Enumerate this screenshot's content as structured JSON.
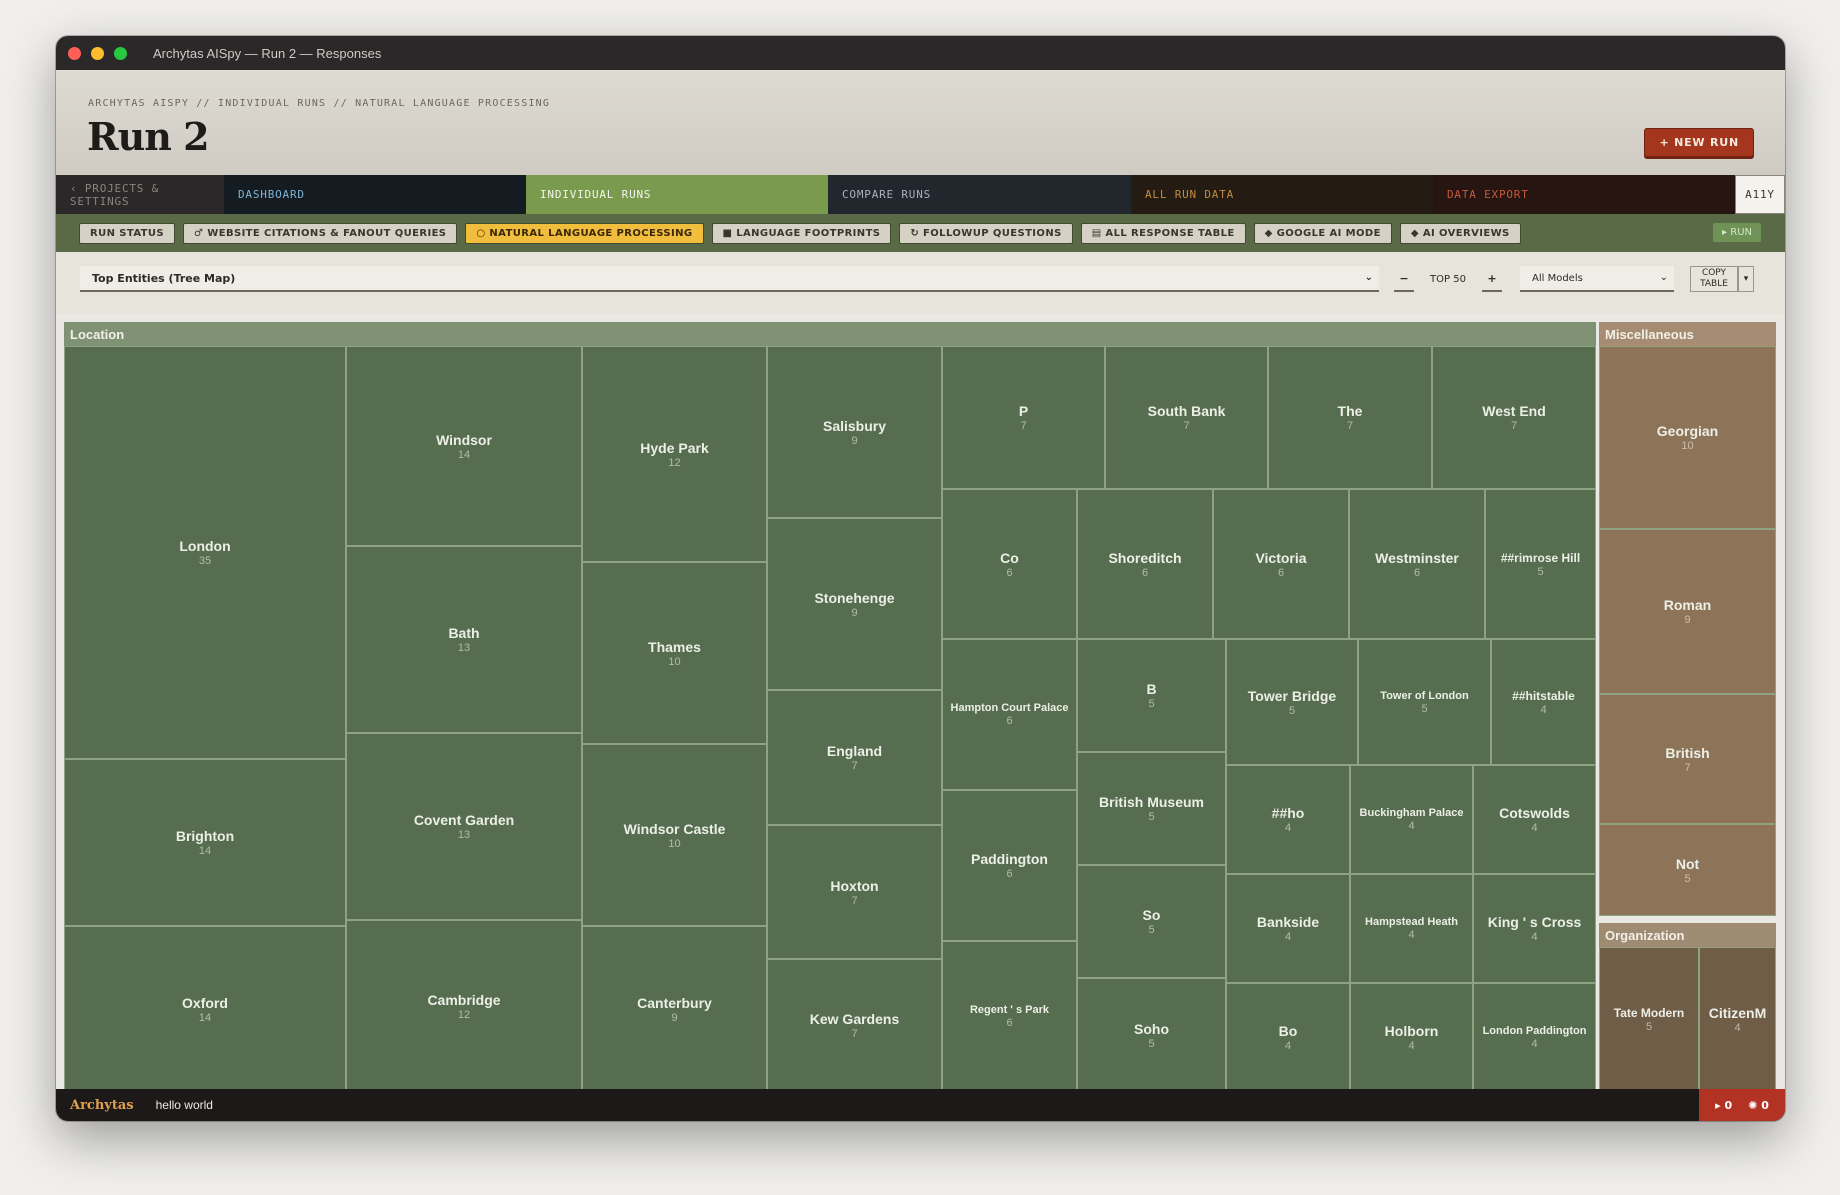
{
  "window": {
    "title": "Archytas AISpy — Run 2 — Responses"
  },
  "header": {
    "breadcrumb": "ARCHYTAS AISPY // INDIVIDUAL RUNS // NATURAL LANGUAGE PROCESSING",
    "title": "Run 2",
    "new_run": "+ NEW RUN"
  },
  "nav": {
    "tabs": [
      {
        "label": "‹ PROJECTS & SETTINGS",
        "bg": "#2a2828",
        "fg": "#8b857c"
      },
      {
        "label": "DASHBOARD",
        "bg": "#141c22",
        "fg": "#7fb2d6"
      },
      {
        "label": "INDIVIDUAL RUNS",
        "bg": "#7a9a4e",
        "fg": "#f3f6ee"
      },
      {
        "label": "COMPARE RUNS",
        "bg": "#22272d",
        "fg": "#a9b1ba"
      },
      {
        "label": "ALL RUN DATA",
        "bg": "#241c12",
        "fg": "#c38a45"
      },
      {
        "label": "DATA EXPORT",
        "bg": "#271512",
        "fg": "#c45a3b"
      }
    ],
    "a11y": "A11Y"
  },
  "subnav": {
    "items": [
      {
        "label": "RUN STATUS",
        "active": false
      },
      {
        "label": "♂ WEBSITE CITATIONS & FANOUT QUERIES",
        "active": false
      },
      {
        "label": "○ NATURAL LANGUAGE PROCESSING",
        "active": true
      },
      {
        "label": "■ LANGUAGE FOOTPRINTS",
        "active": false
      },
      {
        "label": "↻ FOLLOWUP QUESTIONS",
        "active": false
      },
      {
        "label": "▤ ALL RESPONSE TABLE",
        "active": false
      },
      {
        "label": "◆ GOOGLE AI MODE",
        "active": false
      },
      {
        "label": "◆ AI OVERVIEWS",
        "active": false
      }
    ],
    "run": "▸ RUN"
  },
  "controls": {
    "view": "Top Entities (Tree Map)",
    "minus": "−",
    "top": "TOP 50",
    "plus": "+",
    "models": "All Models",
    "copy": "COPY TABLE",
    "extra": "▾"
  },
  "chart_data": {
    "type": "treemap",
    "groups": [
      {
        "name": "Location",
        "items": [
          {
            "label": "London",
            "value": 35
          },
          {
            "label": "Brighton",
            "value": 14
          },
          {
            "label": "Oxford",
            "value": 14
          },
          {
            "label": "Windsor",
            "value": 14
          },
          {
            "label": "Bath",
            "value": 13
          },
          {
            "label": "Covent Garden",
            "value": 13
          },
          {
            "label": "Cambridge",
            "value": 12
          },
          {
            "label": "Hyde Park",
            "value": 12
          },
          {
            "label": "Thames",
            "value": 10
          },
          {
            "label": "Windsor Castle",
            "value": 10
          },
          {
            "label": "Canterbury",
            "value": 9
          },
          {
            "label": "Salisbury",
            "value": 9
          },
          {
            "label": "Stonehenge",
            "value": 9
          },
          {
            "label": "England",
            "value": 7
          },
          {
            "label": "Hoxton",
            "value": 7
          },
          {
            "label": "Kew Gardens",
            "value": 7
          },
          {
            "label": "P",
            "value": 7
          },
          {
            "label": "South Bank",
            "value": 7
          },
          {
            "label": "The",
            "value": 7
          },
          {
            "label": "West End",
            "value": 7
          },
          {
            "label": "Co",
            "value": 6
          },
          {
            "label": "Shoreditch",
            "value": 6
          },
          {
            "label": "Victoria",
            "value": 6
          },
          {
            "label": "Westminster",
            "value": 6
          },
          {
            "label": "##rimrose Hill",
            "value": 5
          },
          {
            "label": "Hampton Court Palace",
            "value": 6
          },
          {
            "label": "Paddington",
            "value": 6
          },
          {
            "label": "Regent ' s Park",
            "value": 6
          },
          {
            "label": "B",
            "value": 5
          },
          {
            "label": "British Museum",
            "value": 5
          },
          {
            "label": "So",
            "value": 5
          },
          {
            "label": "Soho",
            "value": 5
          },
          {
            "label": "Tower Bridge",
            "value": 5
          },
          {
            "label": "Tower of London",
            "value": 5
          },
          {
            "label": "##hitstable",
            "value": 4
          },
          {
            "label": "##ho",
            "value": 4
          },
          {
            "label": "Buckingham Palace",
            "value": 4
          },
          {
            "label": "Cotswolds",
            "value": 4
          },
          {
            "label": "Bankside",
            "value": 4
          },
          {
            "label": "Hampstead Heath",
            "value": 4
          },
          {
            "label": "King ' s Cross",
            "value": 4
          },
          {
            "label": "Bo",
            "value": 4
          },
          {
            "label": "Holborn",
            "value": 4
          },
          {
            "label": "London Paddington",
            "value": 4
          }
        ]
      },
      {
        "name": "Miscellaneous",
        "items": [
          {
            "label": "Georgian",
            "value": 10
          },
          {
            "label": "Roman",
            "value": 9
          },
          {
            "label": "British",
            "value": 7
          },
          {
            "label": "Not",
            "value": 5
          }
        ]
      },
      {
        "name": "Organization",
        "items": [
          {
            "label": "Tate Modern",
            "value": 5
          },
          {
            "label": "CitizenM",
            "value": 4
          }
        ]
      }
    ],
    "colors": {
      "Location": "#566d50",
      "Location_header": "#7f9273",
      "Miscellaneous": "#8d7459",
      "Miscellaneous_header": "#a58c72",
      "Organization": "#6f5d48",
      "Organization_header": "#9f8a72",
      "border": "#8fa281"
    }
  },
  "footer": {
    "brand": "Archytas",
    "message": "hello world",
    "runs": "▸ 0",
    "bugs": "✺ 0"
  }
}
